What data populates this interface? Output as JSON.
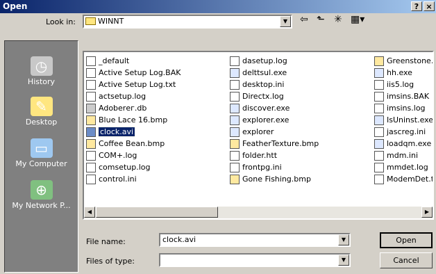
{
  "window": {
    "title": "Open",
    "help_label": "?",
    "close_label": "×"
  },
  "lookin": {
    "label": "Look in:",
    "value": "WINNT",
    "icons": [
      "back-arrow-icon",
      "up-folder-icon",
      "new-folder-icon",
      "view-menu-icon"
    ]
  },
  "places": [
    "History",
    "Desktop",
    "My Computer",
    "My Network P..."
  ],
  "files": {
    "col1": [
      {
        "name": "_default",
        "icon": "doc"
      },
      {
        "name": "Active Setup Log.BAK",
        "icon": "doc"
      },
      {
        "name": "Active Setup Log.txt",
        "icon": "doc"
      },
      {
        "name": "actsetup.log",
        "icon": "doc"
      },
      {
        "name": "Adoberег.db",
        "icon": "db"
      },
      {
        "name": "Blue Lace 16.bmp",
        "icon": "bmp"
      },
      {
        "name": "clock.avi",
        "icon": "avi",
        "selected": true
      },
      {
        "name": "Coffee Bean.bmp",
        "icon": "bmp"
      },
      {
        "name": "COM+.log",
        "icon": "doc"
      },
      {
        "name": "comsetup.log",
        "icon": "doc"
      },
      {
        "name": "control.ini",
        "icon": "doc"
      }
    ],
    "col2": [
      {
        "name": "dasetup.log",
        "icon": "doc"
      },
      {
        "name": "delttsul.exe",
        "icon": "exe"
      },
      {
        "name": "desktop.ini",
        "icon": "doc"
      },
      {
        "name": "Directx.log",
        "icon": "doc"
      },
      {
        "name": "discover.exe",
        "icon": "exe"
      },
      {
        "name": "explorer.exe",
        "icon": "exe"
      },
      {
        "name": "explorer",
        "icon": "exe"
      },
      {
        "name": "FeatherTexture.bmp",
        "icon": "bmp"
      },
      {
        "name": "folder.htt",
        "icon": "doc"
      },
      {
        "name": "frontpg.ini",
        "icon": "doc"
      },
      {
        "name": "Gone Fishing.bmp",
        "icon": "bmp"
      }
    ],
    "col3": [
      {
        "name": "Greenstone.b",
        "icon": "bmp"
      },
      {
        "name": "hh.exe",
        "icon": "exe"
      },
      {
        "name": "iis5.log",
        "icon": "doc"
      },
      {
        "name": "imsins.BAK",
        "icon": "doc"
      },
      {
        "name": "imsins.log",
        "icon": "doc"
      },
      {
        "name": "IsUninst.exe",
        "icon": "exe"
      },
      {
        "name": "jascreg.ini",
        "icon": "doc"
      },
      {
        "name": "loadqm.exe",
        "icon": "exe"
      },
      {
        "name": "mdm.ini",
        "icon": "doc"
      },
      {
        "name": "mmdet.log",
        "icon": "doc"
      },
      {
        "name": "ModemDet.tx",
        "icon": "doc"
      }
    ]
  },
  "filename": {
    "label": "File name:",
    "value": "clock.avi"
  },
  "filetype": {
    "label": "Files of type:",
    "value": ""
  },
  "buttons": {
    "open": "Open",
    "cancel": "Cancel"
  },
  "colors": {
    "title_start": "#0a246a",
    "title_end": "#a6caf0",
    "face": "#d4d0c8",
    "selection": "#0a246a"
  }
}
